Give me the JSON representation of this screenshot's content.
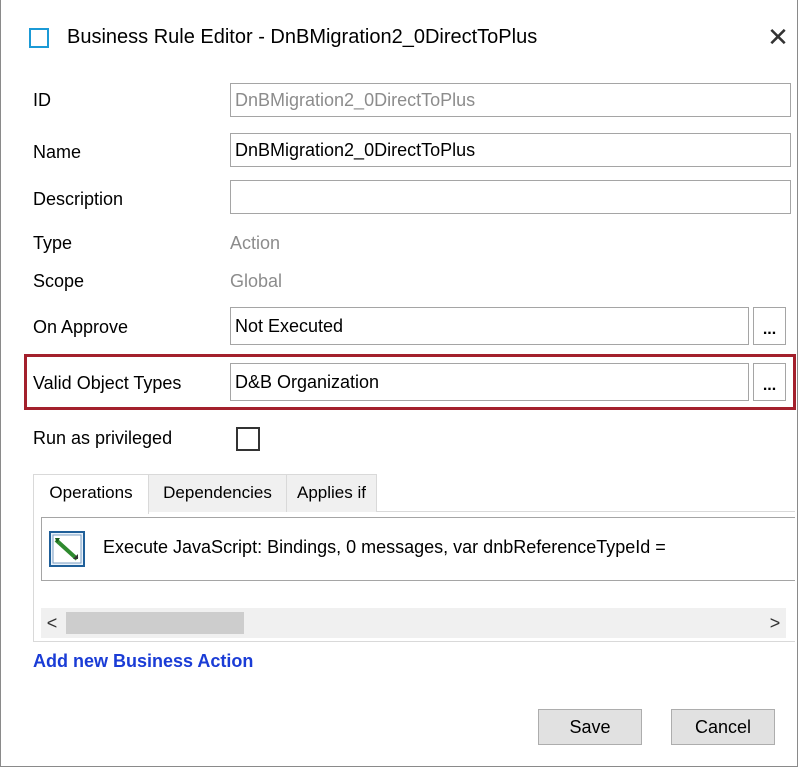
{
  "window": {
    "title": "Business Rule Editor - DnBMigration2_0DirectToPlus",
    "close_glyph": "✕"
  },
  "form": {
    "id_label": "ID",
    "id_value": "DnBMigration2_0DirectToPlus",
    "name_label": "Name",
    "name_value": "DnBMigration2_0DirectToPlus",
    "description_label": "Description",
    "description_value": "",
    "type_label": "Type",
    "type_value": "Action",
    "scope_label": "Scope",
    "scope_value": "Global",
    "on_approve_label": "On Approve",
    "on_approve_value": "Not Executed",
    "valid_object_types_label": "Valid Object Types",
    "valid_object_types_value": "D&B Organization",
    "run_as_privileged_label": "Run as privileged",
    "run_as_privileged_checked": false,
    "ellipsis": "..."
  },
  "tabs": {
    "items": [
      {
        "label": "Operations",
        "active": true
      },
      {
        "label": "Dependencies",
        "active": false
      },
      {
        "label": "Applies if",
        "active": false
      }
    ]
  },
  "operations": {
    "rows": [
      {
        "text": "Execute JavaScript: Bindings, 0 messages, var dnbReferenceTypeId =",
        "icon": "javascript-action-icon"
      }
    ]
  },
  "scrollbar": {
    "left_glyph": "<",
    "right_glyph": ">"
  },
  "actions": {
    "add_link": "Add new Business Action",
    "save_label": "Save",
    "cancel_label": "Cancel"
  },
  "colors": {
    "highlight": "#a3202c",
    "link": "#1a3cd6",
    "app_icon": "#1b9ad6"
  }
}
